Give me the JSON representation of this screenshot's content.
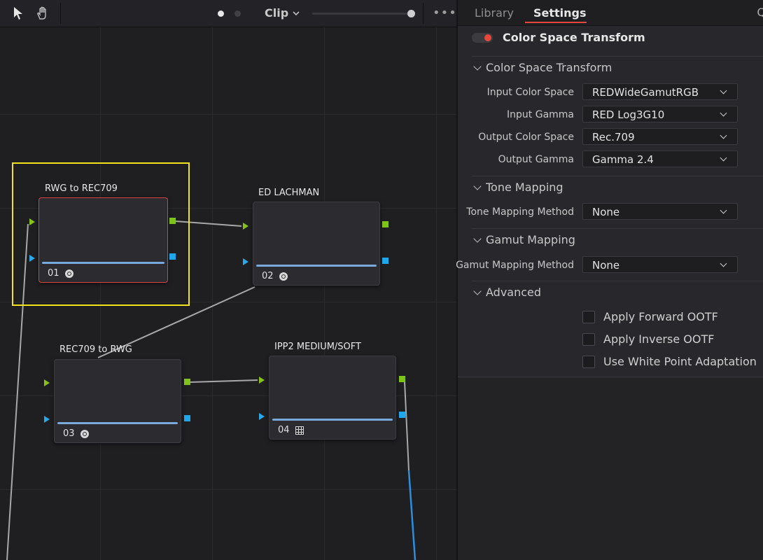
{
  "toolbar": {
    "clip_label": "Clip",
    "more_label": "•••"
  },
  "nodes": [
    {
      "id": "01",
      "label": "RWG to REC709",
      "icon": "fx-icon"
    },
    {
      "id": "02",
      "label": "ED LACHMAN",
      "icon": "fx-icon"
    },
    {
      "id": "03",
      "label": "REC709 to RWG",
      "icon": "fx-icon"
    },
    {
      "id": "04",
      "label": "IPP2 MEDIUM/SOFT",
      "icon": "grid-icon"
    }
  ],
  "inspector": {
    "tabs": [
      "Library",
      "Settings"
    ],
    "active_tab": "Settings",
    "plugin_title": "Color Space Transform",
    "plugin_enabled": true,
    "sections": {
      "cst": {
        "title": "Color Space Transform",
        "rows": [
          {
            "label": "Input Color Space",
            "value": "REDWideGamutRGB"
          },
          {
            "label": "Input Gamma",
            "value": "RED Log3G10"
          },
          {
            "label": "Output Color Space",
            "value": "Rec.709"
          },
          {
            "label": "Output Gamma",
            "value": "Gamma 2.4"
          }
        ]
      },
      "tone": {
        "title": "Tone Mapping",
        "rows": [
          {
            "label": "Tone Mapping Method",
            "value": "None"
          }
        ]
      },
      "gamut": {
        "title": "Gamut Mapping",
        "rows": [
          {
            "label": "Gamut Mapping Method",
            "value": "None"
          }
        ]
      },
      "advanced": {
        "title": "Advanced",
        "checkboxes": [
          {
            "label": "Apply Forward OOTF",
            "checked": false
          },
          {
            "label": "Apply Inverse OOTF",
            "checked": false
          },
          {
            "label": "Use White Point Adaptation",
            "checked": false
          }
        ]
      }
    }
  },
  "colors": {
    "accent": "#e0483c",
    "selection": "#f2e21c",
    "rgb_port": "#7fc31a",
    "alpha_port": "#1ea7ec"
  }
}
